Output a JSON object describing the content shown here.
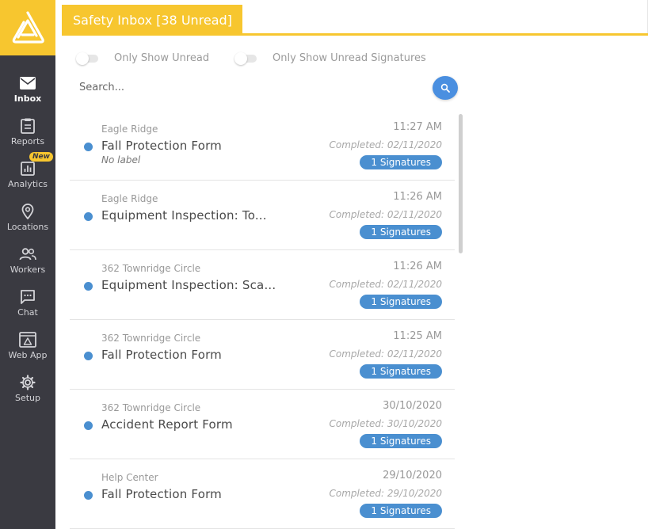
{
  "app": {
    "brand_color": "#f7c62f",
    "sidebar_color": "#3a3a41",
    "accent_color": "#4a8fd0"
  },
  "sidebar": {
    "logo_icon": "triangle-logo-icon",
    "items": [
      {
        "label": "Inbox",
        "icon": "mail-icon",
        "active": true
      },
      {
        "label": "Reports",
        "icon": "clipboard-icon"
      },
      {
        "label": "Analytics",
        "icon": "bar-chart-icon",
        "badge": "New"
      },
      {
        "label": "Locations",
        "icon": "map-pin-icon"
      },
      {
        "label": "Workers",
        "icon": "people-icon"
      },
      {
        "label": "Chat",
        "icon": "chat-icon"
      },
      {
        "label": "Web App",
        "icon": "web-app-icon"
      },
      {
        "label": "Setup",
        "icon": "gear-icon"
      }
    ]
  },
  "header": {
    "title": "Safety Inbox [38 Unread]"
  },
  "filters": {
    "only_unread": "Only Show Unread",
    "only_unread_signatures": "Only Show Unread Signatures"
  },
  "search": {
    "placeholder": "Search...",
    "icon": "search-icon"
  },
  "list": [
    {
      "location": "Eagle Ridge",
      "title": "Fall Protection Form",
      "sublabel": "No label",
      "time": "11:27 AM",
      "completed": "Completed: 02/11/2020",
      "badge": "1 Signatures"
    },
    {
      "location": "Eagle Ridge",
      "title": "Equipment Inspection: To...",
      "time": "11:26 AM",
      "completed": "Completed: 02/11/2020",
      "badge": "1 Signatures"
    },
    {
      "location": "362 Townridge Circle",
      "title": "Equipment Inspection: Sca...",
      "time": "11:26 AM",
      "completed": "Completed: 02/11/2020",
      "badge": "1 Signatures"
    },
    {
      "location": "362 Townridge Circle",
      "title": "Fall Protection Form",
      "time": "11:25 AM",
      "completed": "Completed: 02/11/2020",
      "badge": "1 Signatures"
    },
    {
      "location": "362 Townridge Circle",
      "title": "Accident Report Form",
      "time": "30/10/2020",
      "completed": "Completed: 30/10/2020",
      "badge": "1 Signatures"
    },
    {
      "location": "Help Center",
      "title": "Fall Protection Form",
      "time": "29/10/2020",
      "completed": "Completed: 29/10/2020",
      "badge": "1 Signatures"
    }
  ]
}
